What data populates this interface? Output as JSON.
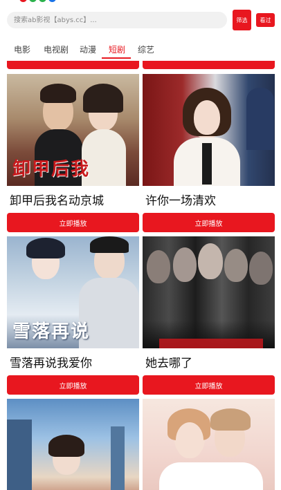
{
  "header": {
    "search_placeholder": "搜索ab影视【abys.cc】...",
    "filter_label": "筛选",
    "history_label": "看过"
  },
  "tabs": [
    {
      "label": "电影"
    },
    {
      "label": "电视剧"
    },
    {
      "label": "动漫"
    },
    {
      "label": "短剧",
      "active": true
    },
    {
      "label": "综艺"
    }
  ],
  "accent_color": "#e8171f",
  "items": [
    {
      "title": "卸甲后我名动京城",
      "poster_text": "卸甲后我",
      "button_label": "立即播放"
    },
    {
      "title": "许你一场清欢",
      "poster_text": "",
      "button_label": "立即播放"
    },
    {
      "title": "雪落再说我爱你",
      "poster_text": "雪落再说",
      "button_label": "立即播放"
    },
    {
      "title": "她去哪了",
      "poster_text": "",
      "button_label": "立即播放"
    },
    {
      "title": "",
      "poster_text": "",
      "button_label": ""
    },
    {
      "title": "",
      "poster_text": "",
      "button_label": ""
    }
  ]
}
